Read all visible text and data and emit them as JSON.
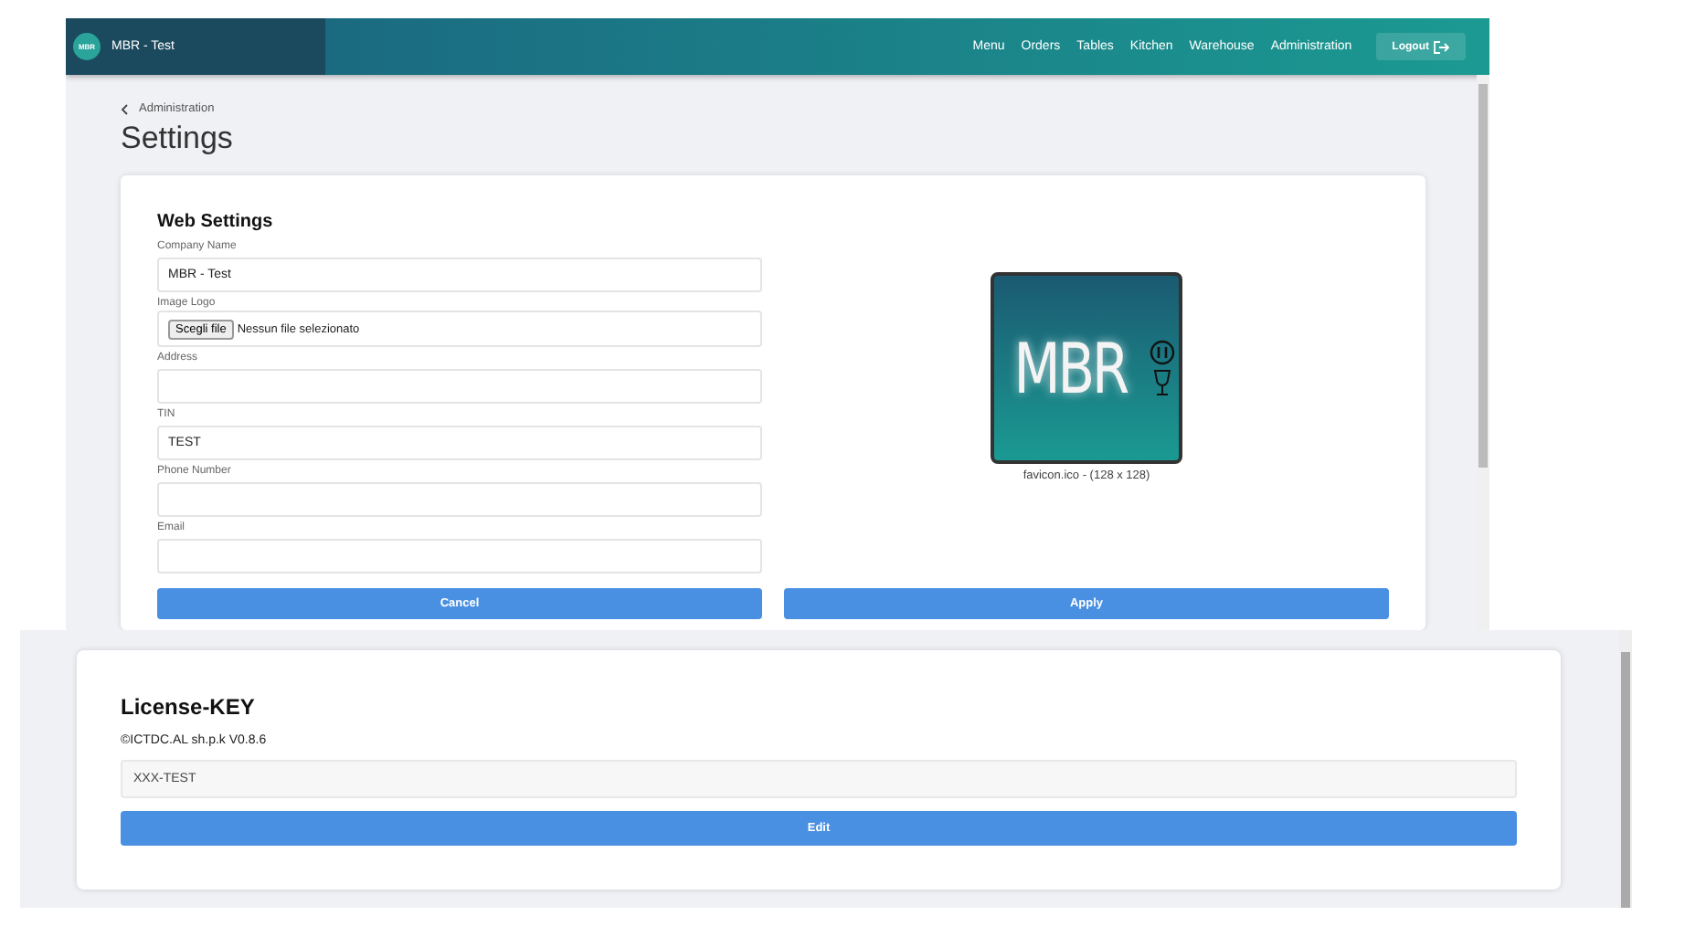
{
  "header": {
    "logo_text": "MBR",
    "title": "MBR - Test",
    "nav": [
      {
        "label": "Menu"
      },
      {
        "label": "Orders"
      },
      {
        "label": "Tables"
      },
      {
        "label": "Kitchen"
      },
      {
        "label": "Warehouse"
      },
      {
        "label": "Administration"
      }
    ],
    "logout": "Logout"
  },
  "breadcrumb": "Administration",
  "page_title": "Settings",
  "web_settings": {
    "title": "Web Settings",
    "fields": [
      {
        "kind": "text",
        "label": "Company Name",
        "value": "MBR - Test"
      },
      {
        "kind": "file",
        "label": "Image Logo",
        "button": "Scegli file",
        "value": "Nessun file selezionato"
      },
      {
        "kind": "text",
        "label": "Address"
      },
      {
        "kind": "text",
        "label": "TIN",
        "value": "TEST"
      },
      {
        "kind": "text",
        "label": "Phone Number"
      },
      {
        "kind": "text",
        "label": "Email"
      }
    ],
    "logo_preview": {
      "text": "MBR",
      "caption": "favicon.ico - (128 x 128)"
    },
    "buttons": [
      "Cancel",
      "Apply"
    ]
  },
  "license": {
    "title": "License-KEY",
    "copyright": "©ICTDC.AL sh.p.k V0.8.6",
    "value": "XXX-TEST",
    "button": "Edit"
  }
}
